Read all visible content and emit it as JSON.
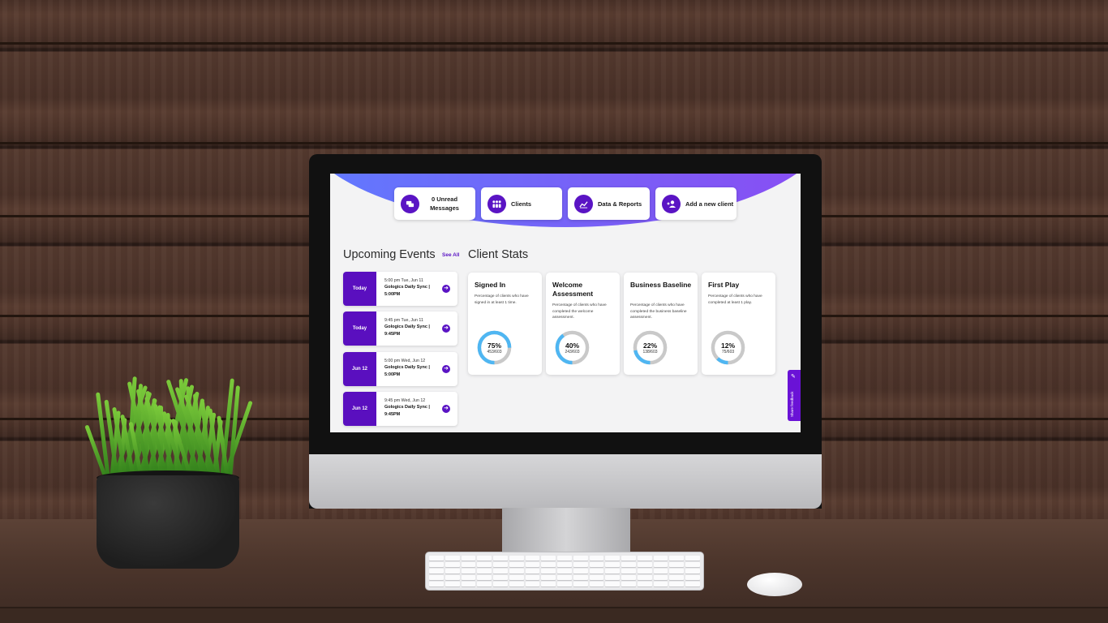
{
  "nav": {
    "messages": {
      "label": "0 Unread Messages",
      "icon": "chat-icon"
    },
    "clients": {
      "label": "Clients",
      "icon": "people-icon"
    },
    "reports": {
      "label": "Data & Reports",
      "icon": "chart-icon"
    },
    "add_client": {
      "label": "Add a new client",
      "icon": "add-user-icon"
    }
  },
  "events": {
    "title": "Upcoming Events",
    "see_all": "See All",
    "items": [
      {
        "date": "Today",
        "time": "5:00 pm Tue, Jun 11",
        "name": "Gologics Daily Sync | 5:00PM"
      },
      {
        "date": "Today",
        "time": "9:45 pm Tue, Jun 11",
        "name": "Gologics Daily Sync | 9:45PM"
      },
      {
        "date": "Jun 12",
        "time": "5:00 pm Wed, Jun 12",
        "name": "Gologics Daily Sync | 5:00PM"
      },
      {
        "date": "Jun 12",
        "time": "9:45 pm Wed, Jun 12",
        "name": "Gologics Daily Sync | 9:45PM"
      }
    ]
  },
  "stats": {
    "title": "Client Stats",
    "cards": [
      {
        "title": "Signed In",
        "desc": "Percentage of clients who have signed in at least 1 time.",
        "pct_label": "75%",
        "fraction": "453/603",
        "value": 0.75
      },
      {
        "title": "Welcome Assessment",
        "desc": "Percentage of clients who have completed the welcome assessment.",
        "pct_label": "40%",
        "fraction": "243/603",
        "value": 0.4
      },
      {
        "title": "Business Baseline",
        "desc": "Percentage of clients who have completed the business baseline assessment.",
        "pct_label": "22%",
        "fraction": "138/603",
        "value": 0.22
      },
      {
        "title": "First Play",
        "desc": "Percentage of clients who have completed at least 1 play.",
        "pct_label": "12%",
        "fraction": "75/603",
        "value": 0.12
      }
    ]
  },
  "feedback": {
    "label": "Share feedback",
    "icon": "feedback-icon"
  },
  "colors": {
    "brand": "#5a14c4",
    "donut_fill": "#4fb6f2",
    "donut_track": "#c9c9c9"
  }
}
